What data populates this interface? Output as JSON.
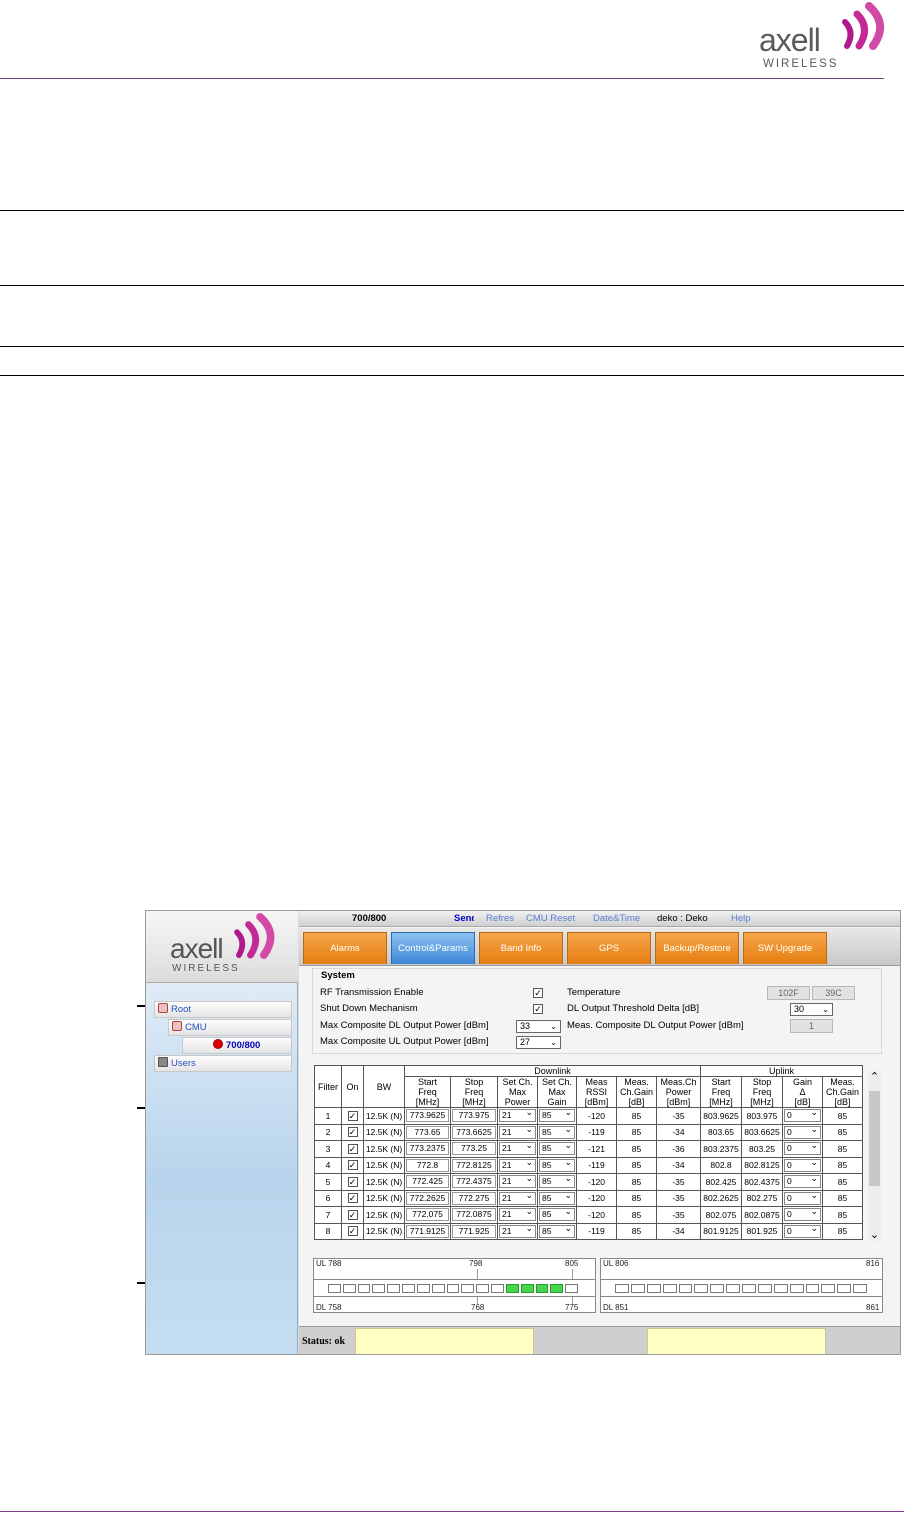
{
  "brand": {
    "name": "axell",
    "sub": "WIRELESS"
  },
  "topbar": {
    "title": "700/800",
    "links": [
      "Send",
      "Refresh",
      "CMU Reset",
      "Date&Time"
    ],
    "user": "deko : Deko",
    "help": "Help"
  },
  "tabs": [
    "Alarms",
    "Control&Params",
    "Band Info",
    "GPS",
    "Backup/Restore",
    "SW Upgrade"
  ],
  "tree": [
    {
      "label": "Root",
      "level": 0
    },
    {
      "label": "CMU",
      "level": 1
    },
    {
      "label": "700/800",
      "level": 2
    },
    {
      "label": "Users",
      "level": 0
    }
  ],
  "system": {
    "title": "System",
    "rf_enable_label": "RF Transmission Enable",
    "shutdown_label": "Shut Down Mechanism",
    "max_dl_label": "Max Composite DL Output Power [dBm]",
    "max_dl_value": "33",
    "max_ul_label": "Max Composite UL Output Power [dBm]",
    "max_ul_value": "27",
    "temperature_label": "Temperature",
    "temp_f": "102F",
    "temp_c": "39C",
    "dl_threshold_label": "DL Output Threshold Delta [dB]",
    "dl_threshold_value": "30",
    "meas_dl_label": "Meas. Composite DL Output Power [dBm]",
    "meas_dl_value": "1"
  },
  "filter_table": {
    "group_downlink": "Downlink",
    "group_uplink": "Uplink",
    "headers": {
      "filter": "Filter",
      "on": "On",
      "bw": "BW",
      "dl_start": [
        "Start",
        "Freq",
        "[MHz]"
      ],
      "dl_stop": [
        "Stop",
        "Freq",
        "[MHz]"
      ],
      "max_power": [
        "Set Ch.",
        "Max",
        "Power"
      ],
      "max_gain": [
        "Set Ch.",
        "Max",
        "Gain"
      ],
      "rssi": [
        "Meas",
        "RSSI",
        "[dBm]"
      ],
      "ch_gain": [
        "Meas.",
        "Ch.Gain",
        "[dB]"
      ],
      "ch_power": [
        "Meas.Ch",
        "Power",
        "[dBm]"
      ],
      "ul_start": [
        "Start",
        "Freq",
        "[MHz]"
      ],
      "ul_stop": [
        "Stop",
        "Freq",
        "[MHz]"
      ],
      "gain_delta": [
        "Gain",
        "Δ",
        "[dB]"
      ],
      "ul_gain": [
        "Meas.",
        "Ch.Gain",
        "[dB]"
      ]
    },
    "rows": [
      [
        "1",
        "12.5K (N)",
        "773.9625",
        "773.975",
        "21",
        "85",
        "-120",
        "85",
        "-35",
        "803.9625",
        "803.975",
        "0",
        "85"
      ],
      [
        "2",
        "12.5K (N)",
        "773.65",
        "773.6625",
        "21",
        "85",
        "-119",
        "85",
        "-34",
        "803.65",
        "803.6625",
        "0",
        "85"
      ],
      [
        "3",
        "12.5K (N)",
        "773.2375",
        "773.25",
        "21",
        "85",
        "-121",
        "85",
        "-36",
        "803.2375",
        "803.25",
        "0",
        "85"
      ],
      [
        "4",
        "12.5K (N)",
        "772.8",
        "772.8125",
        "21",
        "85",
        "-119",
        "85",
        "-34",
        "802.8",
        "802.8125",
        "0",
        "85"
      ],
      [
        "5",
        "12.5K (N)",
        "772.425",
        "772.4375",
        "21",
        "85",
        "-120",
        "85",
        "-35",
        "802.425",
        "802.4375",
        "0",
        "85"
      ],
      [
        "6",
        "12.5K (N)",
        "772.2625",
        "772.275",
        "21",
        "85",
        "-120",
        "85",
        "-35",
        "802.2625",
        "802.275",
        "0",
        "85"
      ],
      [
        "7",
        "12.5K (N)",
        "772.075",
        "772.0875",
        "21",
        "85",
        "-120",
        "85",
        "-35",
        "802.075",
        "802.0875",
        "0",
        "85"
      ],
      [
        "8",
        "12.5K (N)",
        "771.9125",
        "771.925",
        "21",
        "85",
        "-119",
        "85",
        "-34",
        "801.9125",
        "801.925",
        "0",
        "85"
      ]
    ]
  },
  "spectrum": {
    "left": {
      "ul_start": "UL 788",
      "ul_mid": "798",
      "ul_end": "805",
      "dl_start": "DL 758",
      "dl_mid": "768",
      "dl_end": "775",
      "cells": 17,
      "active_from": 12,
      "active_to": 15
    },
    "right": {
      "ul_start": "UL 806",
      "ul_end": "816",
      "dl_start": "DL 851",
      "dl_end": "861",
      "cells": 16
    }
  },
  "status": {
    "label": "Status: ok"
  }
}
